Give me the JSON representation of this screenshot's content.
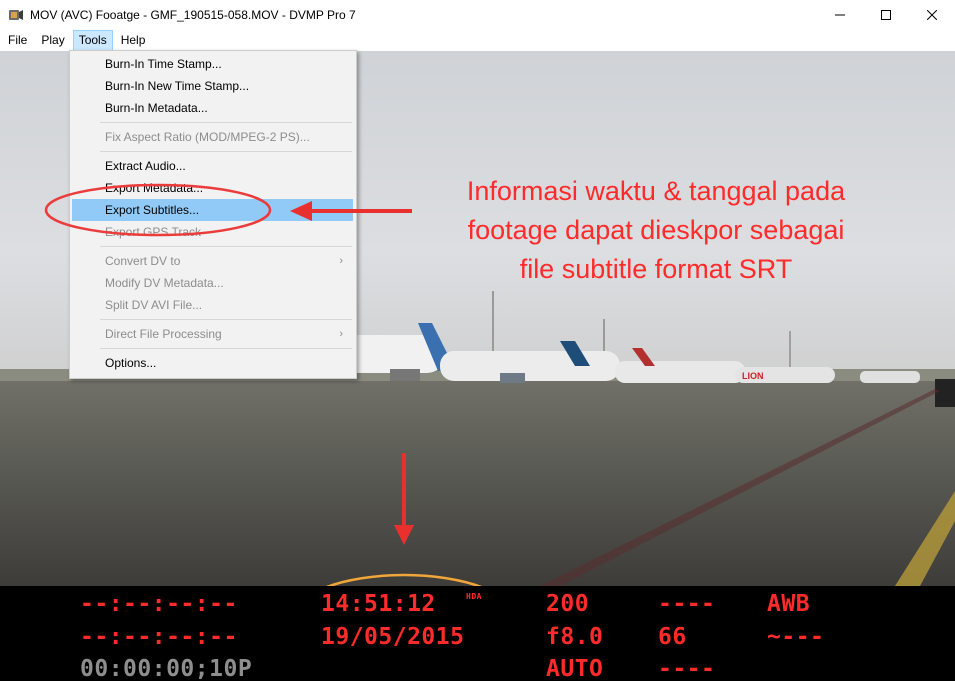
{
  "window": {
    "title": "MOV (AVC) Fooatge - GMF_190515-058.MOV - DVMP Pro 7"
  },
  "menubar": {
    "items": [
      "File",
      "Play",
      "Tools",
      "Help"
    ]
  },
  "tools_menu": {
    "items": [
      {
        "label": "Burn-In Time Stamp...",
        "enabled": true
      },
      {
        "label": "Burn-In New Time Stamp...",
        "enabled": true
      },
      {
        "label": "Burn-In Metadata...",
        "enabled": true
      },
      {
        "label": "Fix Aspect Ratio (MOD/MPEG-2 PS)...",
        "enabled": false
      },
      {
        "label": "Extract Audio...",
        "enabled": true
      },
      {
        "label": "Export Metadata...",
        "enabled": true
      },
      {
        "label": "Export Subtitles...",
        "enabled": true,
        "highlighted": true
      },
      {
        "label": "Export GPS Track",
        "enabled": false
      },
      {
        "label": "Convert DV to",
        "enabled": false,
        "submenu": true
      },
      {
        "label": "Modify DV Metadata...",
        "enabled": false
      },
      {
        "label": "Split DV AVI File...",
        "enabled": false
      },
      {
        "label": "Direct File Processing",
        "enabled": false,
        "submenu": true
      },
      {
        "label": "Options...",
        "enabled": true
      }
    ]
  },
  "annotation": {
    "lines": [
      "Informasi waktu & tanggal pada",
      "footage dapat dieskpor sebagai",
      "file subtitle format SRT"
    ],
    "color": "#ff2a2a"
  },
  "data_panel": {
    "col1": [
      "--:--:--:--",
      "--:--:--:--",
      "00:00:00;10P"
    ],
    "time": "14:51:12",
    "time_flag": "HDA",
    "date": "19/05/2015",
    "col3": [
      "200",
      "f8.0",
      "AUTO"
    ],
    "col4": [
      "----",
      "66",
      "----"
    ],
    "col5": [
      "AWB",
      "~---"
    ]
  }
}
